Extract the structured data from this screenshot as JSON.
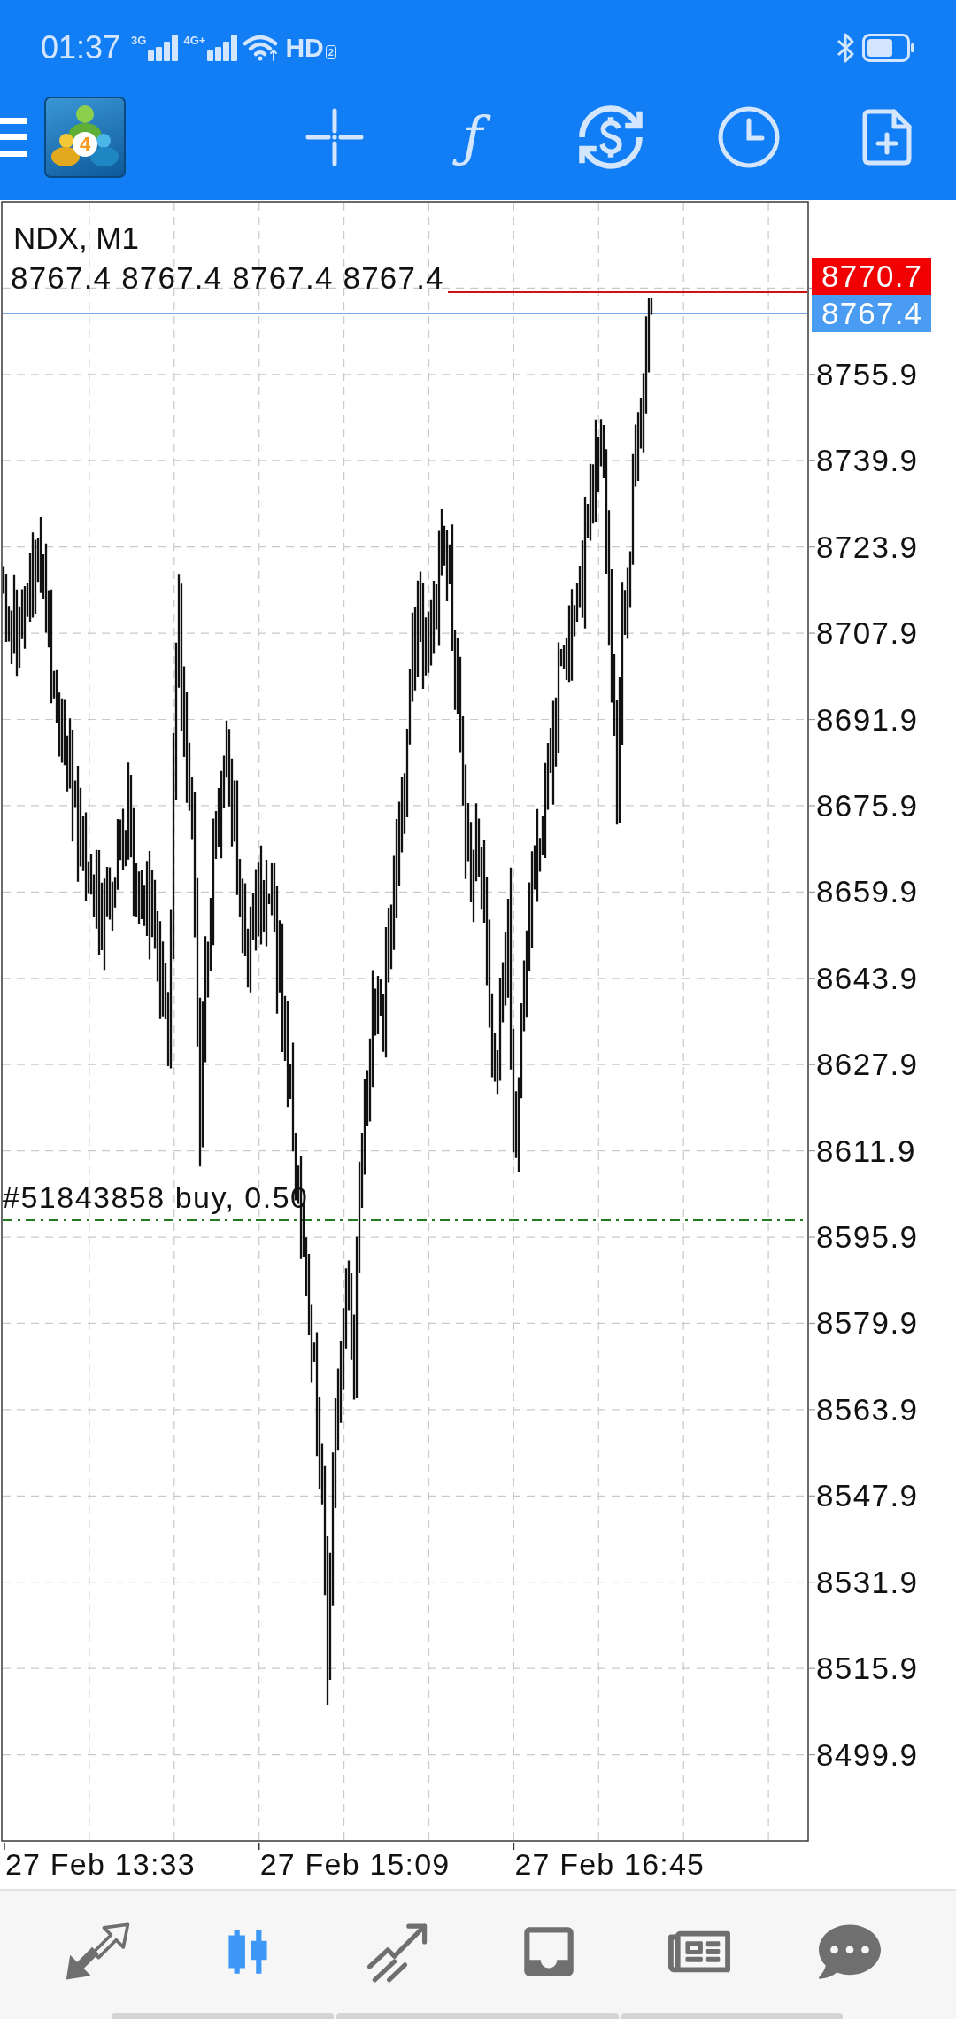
{
  "status_bar": {
    "time": "01:37",
    "networks": [
      {
        "type": "3G"
      },
      {
        "type": "4G+"
      }
    ],
    "hd": "HD",
    "hd_slot": "2"
  },
  "toolbar": {
    "logo_badge": "4",
    "buttons": [
      {
        "kind": "crosshair"
      },
      {
        "kind": "indicators",
        "glyph": "ƒ"
      },
      {
        "kind": "trade"
      },
      {
        "kind": "timeframe"
      },
      {
        "kind": "new_chart"
      }
    ]
  },
  "chart": {
    "symbol": "NDX, M1",
    "ohlc": "8767.4 8767.4 8767.4 8767.4",
    "ask_tag": "8770.7",
    "bid_tag": "8767.4",
    "price_labels": [
      "8755.9",
      "8739.9",
      "8723.9",
      "8707.9",
      "8691.9",
      "8675.9",
      "8659.9",
      "8643.9",
      "8627.9",
      "8611.9",
      "8595.9",
      "8579.9",
      "8563.9",
      "8547.9",
      "8531.9",
      "8515.9",
      "8499.9"
    ],
    "order_label": "#51843858 buy, 0.50",
    "time_labels": [
      "27 Feb 13:33",
      "27 Feb 15:09",
      "27 Feb 16:45"
    ]
  },
  "nav": [
    {
      "kind": "quotes",
      "selected": false
    },
    {
      "kind": "chart",
      "selected": true
    },
    {
      "kind": "trade",
      "selected": false
    },
    {
      "kind": "history",
      "selected": false
    },
    {
      "kind": "news",
      "selected": false
    },
    {
      "kind": "chat",
      "selected": false
    }
  ]
}
